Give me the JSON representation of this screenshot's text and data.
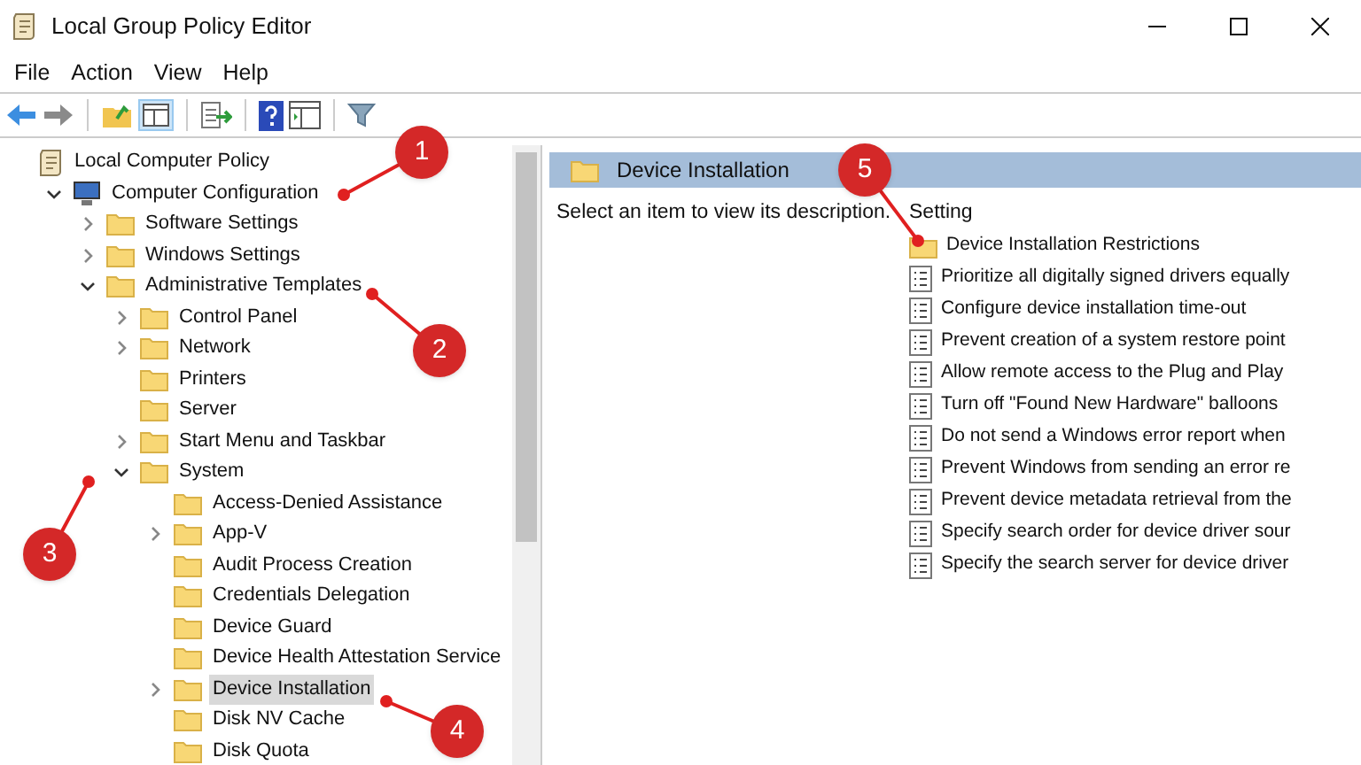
{
  "window": {
    "title": "Local Group Policy Editor"
  },
  "menu": [
    "File",
    "Action",
    "View",
    "Help"
  ],
  "tree": [
    {
      "label": "Local Computer Policy",
      "kind": "policy",
      "selected": false,
      "children": [
        {
          "label": "Computer Configuration",
          "kind": "computer",
          "expandable": true,
          "expanded": true,
          "selected": false,
          "children": [
            {
              "label": "Software Settings",
              "kind": "folder",
              "expandable": true,
              "expanded": false,
              "selected": false
            },
            {
              "label": "Windows Settings",
              "kind": "folder",
              "expandable": true,
              "expanded": false,
              "selected": false
            },
            {
              "label": "Administrative Templates",
              "kind": "folder",
              "expandable": true,
              "expanded": true,
              "selected": false,
              "children": [
                {
                  "label": "Control Panel",
                  "kind": "folder",
                  "expandable": true,
                  "expanded": false,
                  "selected": false
                },
                {
                  "label": "Network",
                  "kind": "folder",
                  "expandable": true,
                  "expanded": false,
                  "selected": false
                },
                {
                  "label": "Printers",
                  "kind": "folder",
                  "expandable": false,
                  "expanded": false,
                  "selected": false
                },
                {
                  "label": "Server",
                  "kind": "folder",
                  "expandable": false,
                  "expanded": false,
                  "selected": false
                },
                {
                  "label": "Start Menu and Taskbar",
                  "kind": "folder",
                  "expandable": true,
                  "expanded": false,
                  "selected": false
                },
                {
                  "label": "System",
                  "kind": "folder",
                  "expandable": true,
                  "expanded": true,
                  "selected": false,
                  "children": [
                    {
                      "label": "Access-Denied Assistance",
                      "kind": "folder",
                      "expandable": false,
                      "expanded": false,
                      "selected": false
                    },
                    {
                      "label": "App-V",
                      "kind": "folder",
                      "expandable": true,
                      "expanded": false,
                      "selected": false
                    },
                    {
                      "label": "Audit Process Creation",
                      "kind": "folder",
                      "expandable": false,
                      "expanded": false,
                      "selected": false
                    },
                    {
                      "label": "Credentials Delegation",
                      "kind": "folder",
                      "expandable": false,
                      "expanded": false,
                      "selected": false
                    },
                    {
                      "label": "Device Guard",
                      "kind": "folder",
                      "expandable": false,
                      "expanded": false,
                      "selected": false
                    },
                    {
                      "label": "Device Health Attestation Service",
                      "kind": "folder",
                      "expandable": false,
                      "expanded": false,
                      "selected": false
                    },
                    {
                      "label": "Device Installation",
                      "kind": "folder",
                      "expandable": true,
                      "expanded": false,
                      "selected": true
                    },
                    {
                      "label": "Disk NV Cache",
                      "kind": "folder",
                      "expandable": false,
                      "expanded": false,
                      "selected": false
                    },
                    {
                      "label": "Disk Quota",
                      "kind": "folder",
                      "expandable": false,
                      "expanded": false,
                      "selected": false
                    }
                  ]
                }
              ]
            }
          ]
        }
      ]
    }
  ],
  "details": {
    "title": "Device Installation",
    "description": "Select an item to view its description.",
    "column": "Setting",
    "items": [
      {
        "label": "Device Installation Restrictions",
        "kind": "folder"
      },
      {
        "label": "Prioritize all digitally signed drivers equally",
        "kind": "setting"
      },
      {
        "label": "Configure device installation time-out",
        "kind": "setting"
      },
      {
        "label": "Prevent creation of a system restore point",
        "kind": "setting"
      },
      {
        "label": "Allow remote access to the Plug and Play",
        "kind": "setting"
      },
      {
        "label": "Turn off \"Found New Hardware\" balloons",
        "kind": "setting"
      },
      {
        "label": "Do not send a Windows error report when",
        "kind": "setting"
      },
      {
        "label": "Prevent Windows from sending an error re",
        "kind": "setting"
      },
      {
        "label": "Prevent device metadata retrieval from the",
        "kind": "setting"
      },
      {
        "label": "Specify search order for device driver sour",
        "kind": "setting"
      },
      {
        "label": "Specify the search server for device driver",
        "kind": "setting"
      }
    ]
  },
  "callouts": [
    "1",
    "2",
    "3",
    "4",
    "5"
  ]
}
